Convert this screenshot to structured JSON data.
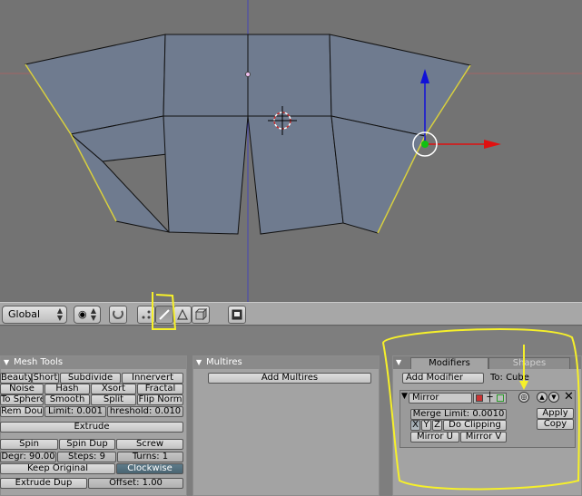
{
  "toolbar": {
    "orientation": "Global",
    "icons": [
      "pivot-icon",
      "snap-magnet-icon",
      "vertex-select-icon",
      "edge-select-icon",
      "face-select-icon",
      "occlude-icon",
      "render-icon"
    ]
  },
  "panels": {
    "mesh_tools": {
      "title": "Mesh Tools",
      "row1": [
        "Beauty",
        "Short",
        "Subdivide",
        "Innervert"
      ],
      "row2": [
        "Noise",
        "Hash",
        "Xsort",
        "Fractal"
      ],
      "row3": [
        "To Sphere",
        "Smooth",
        "Split",
        "Flip Norm"
      ],
      "rem_dou": "Rem Dou",
      "limit": "Limit: 0.001",
      "threshold": "hreshold: 0.010",
      "extrude": "Extrude",
      "spin": "Spin",
      "spin_dup": "Spin Dup",
      "screw": "Screw",
      "degr": "Degr: 90.00",
      "steps": "Steps: 9",
      "turns": "Turns: 1",
      "keep_original": "Keep Original",
      "clockwise": "Clockwise",
      "extrude_dup": "Extrude Dup",
      "offset": "Offset: 1.00"
    },
    "multires": {
      "title": "Multires",
      "add": "Add Multires"
    },
    "modifiers": {
      "tab_modifiers": "Modifiers",
      "tab_shapes": "Shapes",
      "add_modifier": "Add Modifier",
      "to": "To: Cube",
      "mirror_name": "Mirror",
      "merge_limit": "Merge Limit: 0.0010",
      "x": "X",
      "y": "Y",
      "z": "Z",
      "do_clipping": "Do Clipping",
      "mirror_u": "Mirror U",
      "mirror_v": "Mirror V",
      "apply": "Apply",
      "copy": "Copy"
    }
  },
  "colors": {
    "mesh_face": "#6f7b8f",
    "viewport_bg": "#737373",
    "annotation_yellow": "#f6f02a",
    "axis_red": "#e01010",
    "axis_blue": "#1010d8",
    "axis_green": "#10c010"
  }
}
